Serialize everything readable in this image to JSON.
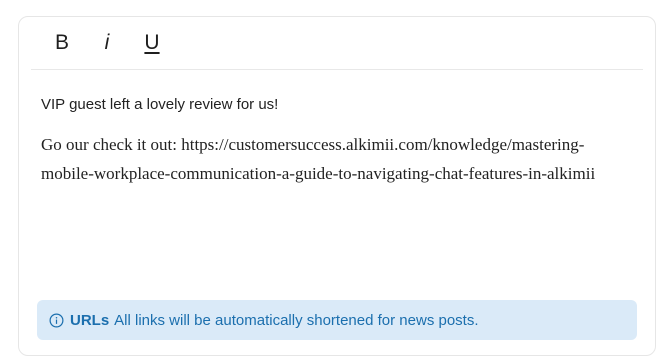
{
  "toolbar": {
    "bold_label": "B",
    "italic_label": "i",
    "underline_label": "U"
  },
  "content": {
    "line1": "VIP guest left a lovely review for us!",
    "line2": "Go our check it out: https://customersuccess.alkimii.com/knowledge/mastering-mobile-workplace-communication-a-guide-to-navigating-chat-features-in-alkimii"
  },
  "notice": {
    "icon": "info-icon",
    "title": "URLs",
    "text": "All links will be automatically shortened for news posts.",
    "color": "#1b6fae",
    "background": "#daeaf8"
  }
}
